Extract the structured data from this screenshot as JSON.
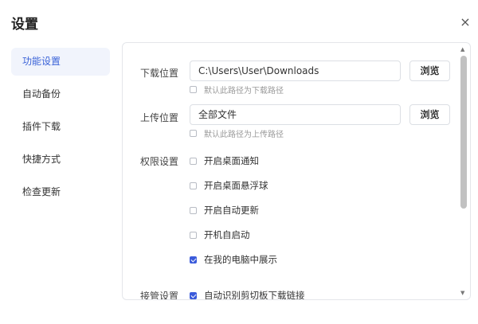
{
  "dialog": {
    "title": "设置",
    "close_icon": "×"
  },
  "sidebar": {
    "items": [
      {
        "label": "功能设置",
        "active": true
      },
      {
        "label": "自动备份",
        "active": false
      },
      {
        "label": "插件下载",
        "active": false
      },
      {
        "label": "快捷方式",
        "active": false
      },
      {
        "label": "检查更新",
        "active": false
      }
    ]
  },
  "download": {
    "label": "下载位置",
    "path": "C:\\Users\\User\\Downloads",
    "browse": "浏览",
    "default_hint": "默认此路径为下载路径",
    "default_checked": false
  },
  "upload": {
    "label": "上传位置",
    "path": "全部文件",
    "browse": "浏览",
    "default_hint": "默认此路径为上传路径",
    "default_checked": false
  },
  "permissions": {
    "label": "权限设置",
    "options": [
      {
        "label": "开启桌面通知",
        "checked": false
      },
      {
        "label": "开启桌面悬浮球",
        "checked": false
      },
      {
        "label": "开启自动更新",
        "checked": false
      },
      {
        "label": "开机自启动",
        "checked": false
      },
      {
        "label": "在我的电脑中展示",
        "checked": true
      }
    ]
  },
  "takeover": {
    "label": "接管设置",
    "options": [
      {
        "label": "自动识别剪切板下载链接",
        "checked": true
      }
    ]
  },
  "scrollbar": {
    "up_icon": "▲",
    "down_icon": "▼"
  },
  "colors": {
    "accent": "#3b63d8",
    "checkbox": "#3b5bdb",
    "active_bg": "#f1f4fc"
  }
}
